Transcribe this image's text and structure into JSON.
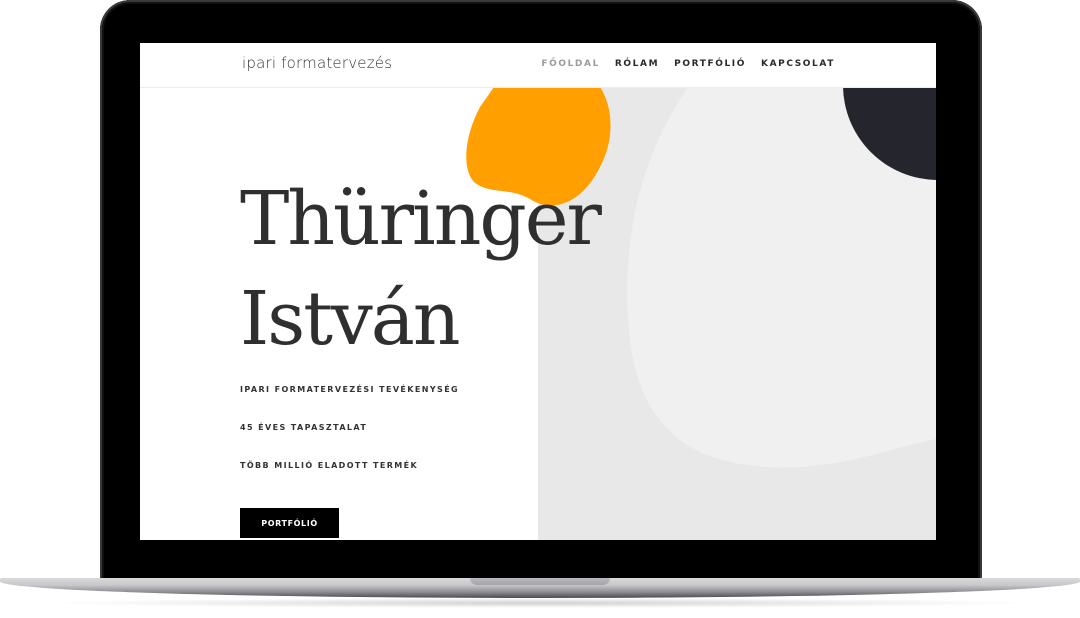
{
  "site": {
    "logo": "ipari formatervezés",
    "nav": [
      {
        "label": "FŐOLDAL",
        "active": true
      },
      {
        "label": "RÓLAM",
        "active": false
      },
      {
        "label": "PORTFÓLIÓ",
        "active": false
      },
      {
        "label": "KAPCSOLAT",
        "active": false
      }
    ]
  },
  "hero": {
    "name_line1": "Thüringer",
    "name_line2": "István",
    "features": [
      "IPARI FORMATERVEZÉSI TEVÉKENYSÉG",
      "45 ÉVES TAPASZTALAT",
      "TÖBB MILLIÓ ELADOTT TERMÉK"
    ],
    "cta_label": "PORTFÓLIÓ"
  },
  "colors": {
    "accent_orange": "#ffa000",
    "dark_circle": "#25252d",
    "panel_gray": "#e8e8e9",
    "button_bg": "#000000"
  }
}
